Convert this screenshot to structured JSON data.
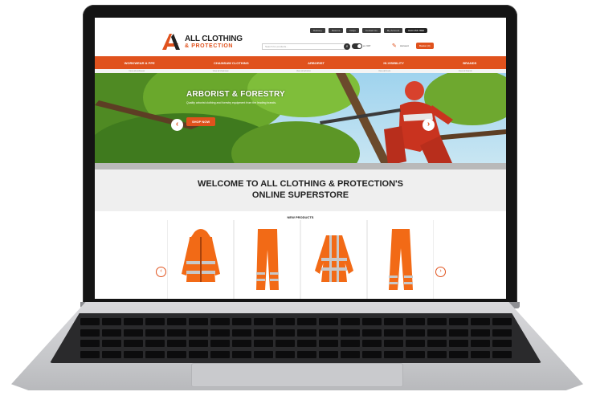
{
  "header": {
    "top_links": [
      "Delivery",
      "Returns",
      "FAQs",
      "Contact Us",
      "My Account"
    ],
    "phone": "0123 456 7890",
    "logo_line1": "ALL CLOTHING",
    "logo_line2": "& PROTECTION",
    "search_placeholder": "Search for products...",
    "vat_label": "ex VAT",
    "account_label": "Account",
    "basket_label": "Basket (0)"
  },
  "nav": {
    "items": [
      "WORKWEAR & PPE",
      "CHAINSAW CLOTHING",
      "ARBORIST",
      "HI-VISIBILITY",
      "BRANDS"
    ],
    "sub": [
      "View all workwear",
      "View all chainsaw",
      "View all arborist",
      "View all hi-vis",
      "View all brands"
    ]
  },
  "hero": {
    "title": "ARBORIST & FORESTRY",
    "subtitle": "Quality arborist clothing and forestry equipment from the leading brands.",
    "cta": "SHOP NOW"
  },
  "welcome": {
    "line1": "WELCOME TO ALL CLOTHING & PROTECTION'S",
    "line2": "ONLINE SUPERSTORE"
  },
  "new_products": {
    "title": "NEW PRODUCTS",
    "items": [
      "hi-vis-jacket",
      "hi-vis-trousers",
      "hi-vis-fleece",
      "hi-vis-overtrousers"
    ]
  },
  "colors": {
    "accent": "#e0521d",
    "nav": "#e0521d",
    "hivis": "#f26a16",
    "reflective": "#c8c8c8"
  }
}
